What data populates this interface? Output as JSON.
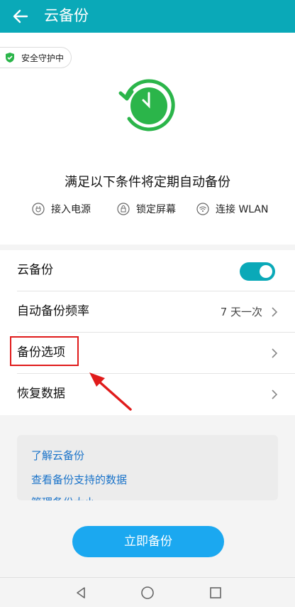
{
  "header": {
    "title": "云备份",
    "back_icon": "back-arrow-icon"
  },
  "security_badge": {
    "label": "安全守护中",
    "icon": "shield-check-icon",
    "color": "#2bb54a"
  },
  "hero": {
    "icon": "clock-sync-icon",
    "condition_title": "满足以下条件将定期自动备份",
    "conditions": [
      {
        "label": "接入电源",
        "icon": "power-plug-icon"
      },
      {
        "label": "锁定屏幕",
        "icon": "lock-icon"
      },
      {
        "label": "连接 WLAN",
        "icon": "wifi-icon"
      }
    ]
  },
  "settings": {
    "cloud_backup": {
      "label": "云备份",
      "enabled": true
    },
    "frequency": {
      "label": "自动备份频率",
      "value": "7 天一次"
    },
    "options": {
      "label": "备份选项"
    },
    "restore": {
      "label": "恢复数据"
    }
  },
  "links": [
    "了解云备份",
    "查看备份支持的数据",
    "管理备份大小"
  ],
  "backup_button": {
    "label": "立即备份"
  },
  "navbar": {
    "back": "nav-back-icon",
    "home": "nav-home-icon",
    "recents": "nav-recents-icon"
  },
  "colors": {
    "accent": "#0aa9b8",
    "button": "#1ba8f0",
    "link": "#1a73c9",
    "annotation": "#e01b1b"
  }
}
